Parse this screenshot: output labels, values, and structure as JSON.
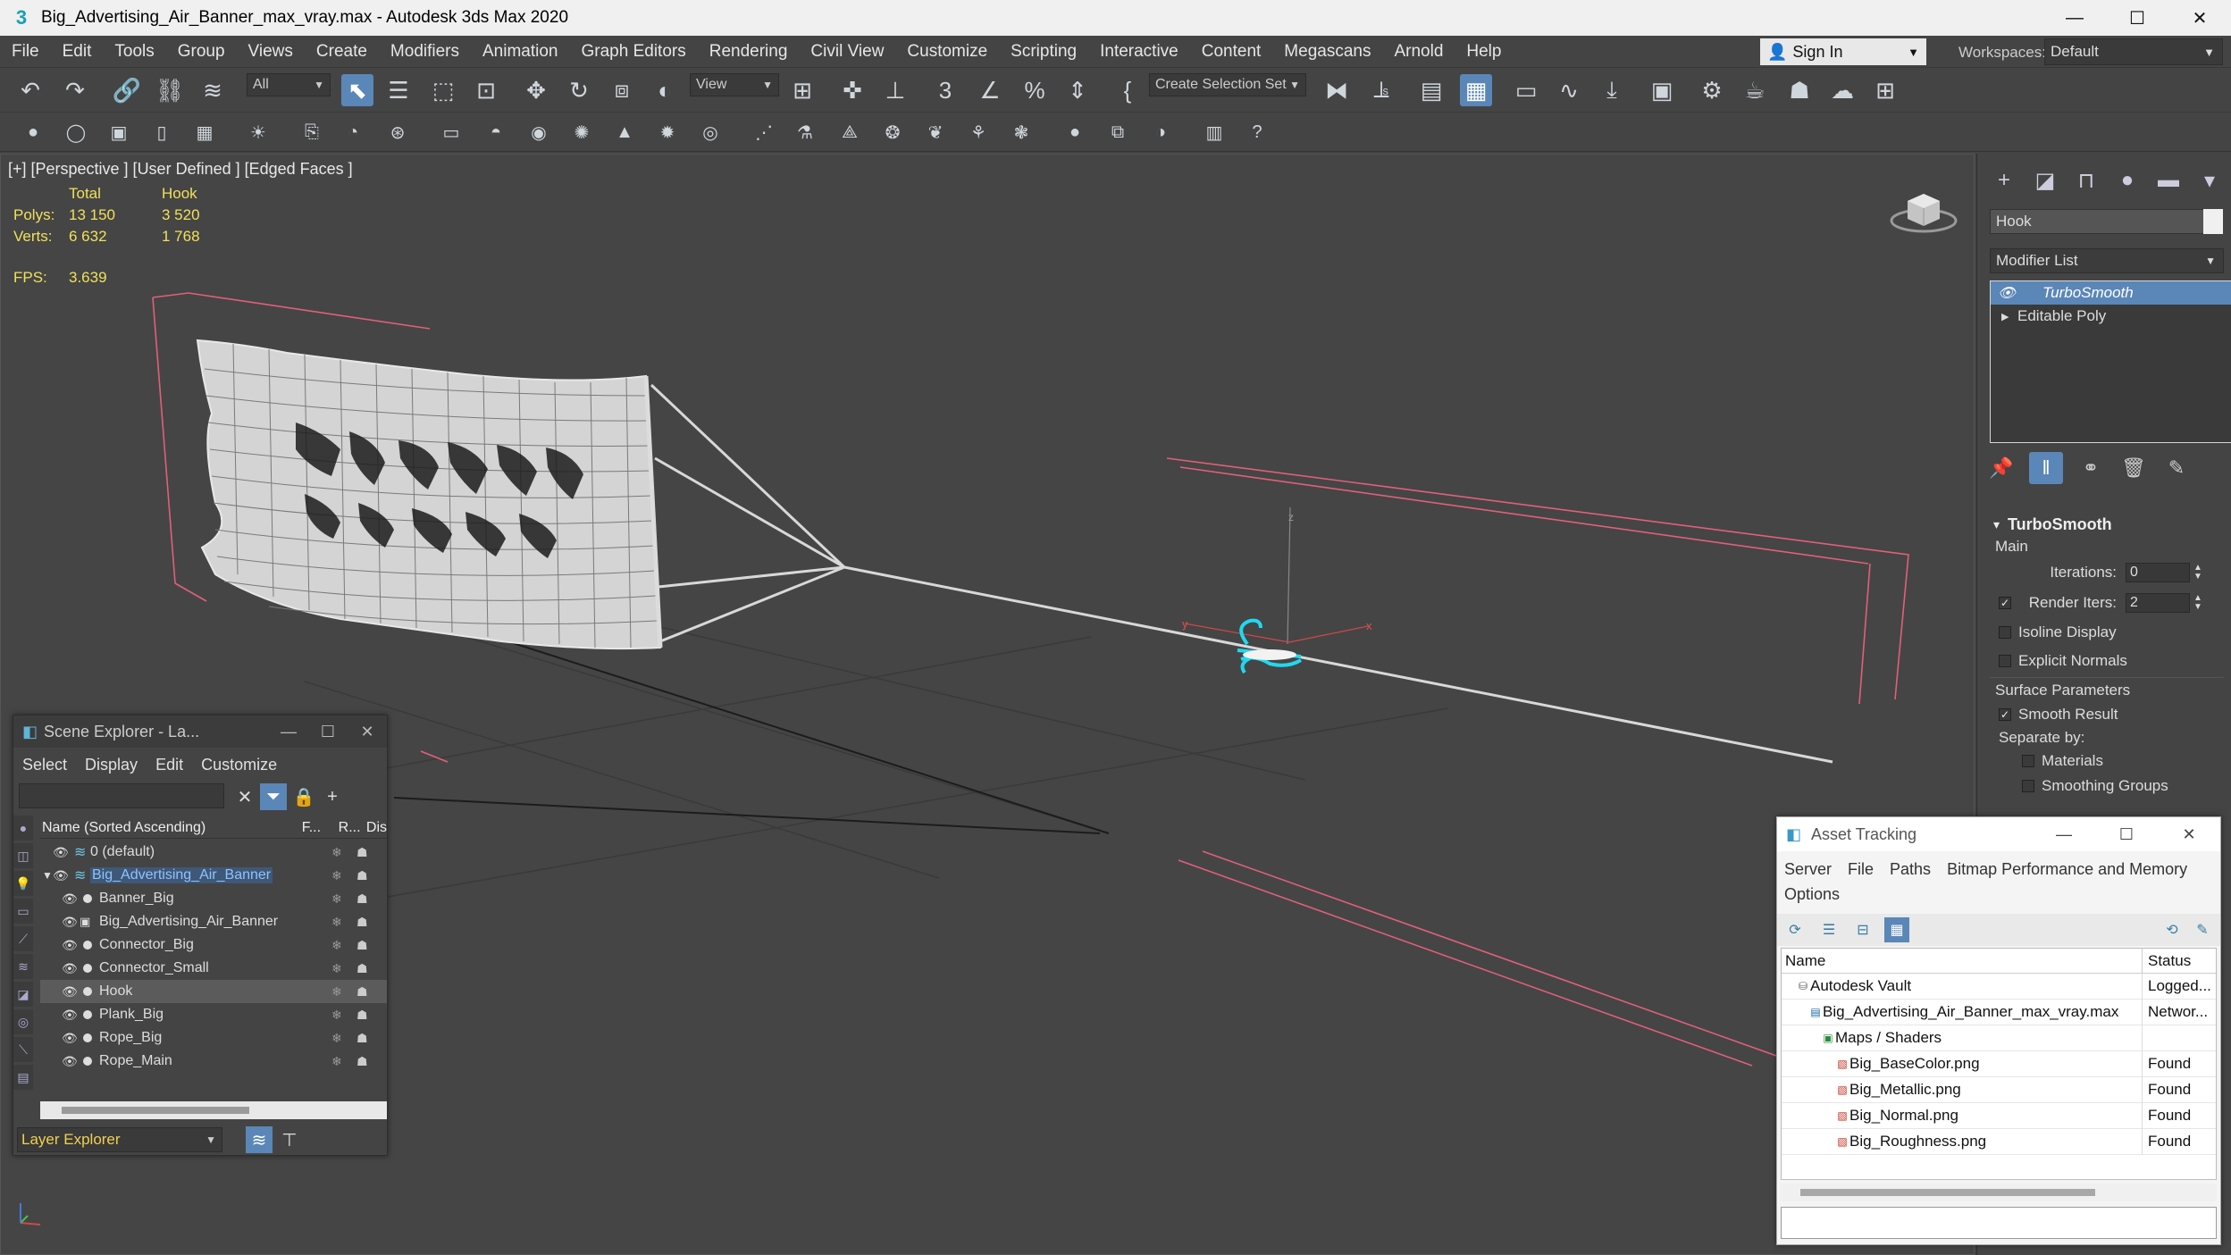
{
  "window": {
    "title": "Big_Advertising_Air_Banner_max_vray.max - Autodesk 3ds Max 2020",
    "minimize": "—",
    "maximize": "☐",
    "close": "✕"
  },
  "menu": [
    "File",
    "Edit",
    "Tools",
    "Group",
    "Views",
    "Create",
    "Modifiers",
    "Animation",
    "Graph Editors",
    "Rendering",
    "Civil View",
    "Customize",
    "Scripting",
    "Interactive",
    "Content",
    "Megascans",
    "Arnold",
    "Help"
  ],
  "account": {
    "sign_in": "Sign In",
    "workspaces_label": "Workspaces:",
    "workspace": "Default"
  },
  "toolbar": {
    "selection_filter": "All",
    "ref_coord": "View",
    "selection_set": "Create Selection Set"
  },
  "viewport": {
    "label": "[+] [Perspective ] [User Defined ] [Edged Faces ]",
    "stats": {
      "col_total": "Total",
      "col_obj": "Hook",
      "polys_label": "Polys:",
      "polys_total": "13 150",
      "polys_obj": "3 520",
      "verts_label": "Verts:",
      "verts_total": "6 632",
      "verts_obj": "1 768",
      "fps_label": "FPS:",
      "fps_value": "3.639"
    },
    "gizmo": {
      "x": "x",
      "y": "y",
      "z": "z"
    }
  },
  "command_panel": {
    "object_name": "Hook",
    "object_color": "#f0f0f0",
    "modifier_list": "Modifier List",
    "stack": [
      {
        "name": "TurboSmooth",
        "selected": true
      },
      {
        "name": "Editable Poly",
        "selected": false
      }
    ],
    "turbosmooth": {
      "title": "TurboSmooth",
      "main": "Main",
      "iterations_label": "Iterations:",
      "iterations": "0",
      "render_iters_label": "Render Iters:",
      "render_iters": "2",
      "isoline": "Isoline Display",
      "explicit": "Explicit Normals",
      "surface_params": "Surface Parameters",
      "smooth_result": "Smooth Result",
      "separate_by": "Separate by:",
      "materials": "Materials",
      "smoothing_groups": "Smoothing Groups"
    }
  },
  "scene_explorer": {
    "title": "Scene Explorer - La...",
    "menu": [
      "Select",
      "Display",
      "Edit",
      "Customize"
    ],
    "col_name": "Name (Sorted Ascending)",
    "col_frozen": "F...",
    "col_render": "R...",
    "col_display": "Dis",
    "rows": [
      {
        "name": "0 (default)",
        "level": 0,
        "kind": "layer",
        "selected": false,
        "highlight": false
      },
      {
        "name": "Big_Advertising_Air_Banner",
        "level": 0,
        "kind": "layer-open",
        "selected": false,
        "highlight": true
      },
      {
        "name": "Banner_Big",
        "level": 1,
        "kind": "obj",
        "selected": false,
        "highlight": false
      },
      {
        "name": "Big_Advertising_Air_Banner",
        "level": 1,
        "kind": "group",
        "selected": false,
        "highlight": false
      },
      {
        "name": "Connector_Big",
        "level": 1,
        "kind": "obj",
        "selected": false,
        "highlight": false
      },
      {
        "name": "Connector_Small",
        "level": 1,
        "kind": "obj",
        "selected": false,
        "highlight": false
      },
      {
        "name": "Hook",
        "level": 1,
        "kind": "obj",
        "selected": true,
        "highlight": false
      },
      {
        "name": "Plank_Big",
        "level": 1,
        "kind": "obj",
        "selected": false,
        "highlight": false
      },
      {
        "name": "Rope_Big",
        "level": 1,
        "kind": "obj",
        "selected": false,
        "highlight": false
      },
      {
        "name": "Rope_Main",
        "level": 1,
        "kind": "obj",
        "selected": false,
        "highlight": false
      }
    ],
    "footer_layer": "Layer Explorer"
  },
  "asset_tracking": {
    "title": "Asset Tracking",
    "menu": [
      "Server",
      "File",
      "Paths",
      "Bitmap Performance and Memory",
      "Options"
    ],
    "col_name": "Name",
    "col_status": "Status",
    "rows": [
      {
        "name": "Autodesk Vault",
        "status": "Logged...",
        "level": 0,
        "icon": "vault-icon"
      },
      {
        "name": "Big_Advertising_Air_Banner_max_vray.max",
        "status": "Networ...",
        "level": 1,
        "icon": "max-file-icon"
      },
      {
        "name": "Maps / Shaders",
        "status": "",
        "level": 2,
        "icon": "folder-icon"
      },
      {
        "name": "Big_BaseColor.png",
        "status": "Found",
        "level": 3,
        "icon": "image-file-icon"
      },
      {
        "name": "Big_Metallic.png",
        "status": "Found",
        "level": 3,
        "icon": "image-file-icon"
      },
      {
        "name": "Big_Normal.png",
        "status": "Found",
        "level": 3,
        "icon": "image-file-icon"
      },
      {
        "name": "Big_Roughness.png",
        "status": "Found",
        "level": 3,
        "icon": "image-file-icon"
      }
    ]
  },
  "colors": {
    "accent": "#5b86b8",
    "stats_yellow": "#f0e05a",
    "hook_cyan": "#21d8f0",
    "bounds_red": "#e0607a"
  }
}
